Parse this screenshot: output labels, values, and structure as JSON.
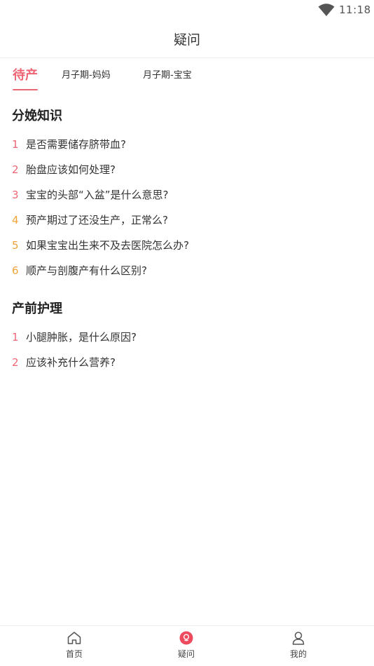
{
  "status_bar": {
    "time": "11:18",
    "wifi_icon": "wifi-icon"
  },
  "header": {
    "title": "疑问"
  },
  "tabs": [
    {
      "label": "待产",
      "active": true
    },
    {
      "label": "月子期-妈妈",
      "active": false
    },
    {
      "label": "月子期-宝宝",
      "active": false
    }
  ],
  "sections": [
    {
      "title": "分娩知识",
      "items": [
        {
          "num": "1",
          "text": "是否需要储存脐带血?",
          "num_color": "#ee6676"
        },
        {
          "num": "2",
          "text": "胎盘应该如何处理?",
          "num_color": "#ee6676"
        },
        {
          "num": "3",
          "text": "宝宝的头部“入盆”是什么意思?",
          "num_color": "#ee6676"
        },
        {
          "num": "4",
          "text": "预产期过了还没生产，正常么?",
          "num_color": "#f0a33a"
        },
        {
          "num": "5",
          "text": "如果宝宝出生来不及去医院怎么办?",
          "num_color": "#f0a33a"
        },
        {
          "num": "6",
          "text": "顺产与剖腹产有什么区别?",
          "num_color": "#f0a33a"
        }
      ]
    },
    {
      "title": "产前护理",
      "items": [
        {
          "num": "1",
          "text": "小腿肿胀，是什么原因?",
          "num_color": "#ee6676"
        },
        {
          "num": "2",
          "text": "应该补充什么营养?",
          "num_color": "#ee6676"
        }
      ]
    }
  ],
  "bottom_nav": [
    {
      "label": "首页",
      "icon": "home-icon",
      "active": false
    },
    {
      "label": "疑问",
      "icon": "question-icon",
      "active": true
    },
    {
      "label": "我的",
      "icon": "user-icon",
      "active": false
    }
  ],
  "colors": {
    "accent": "#ee6676",
    "orange": "#f0a33a"
  }
}
